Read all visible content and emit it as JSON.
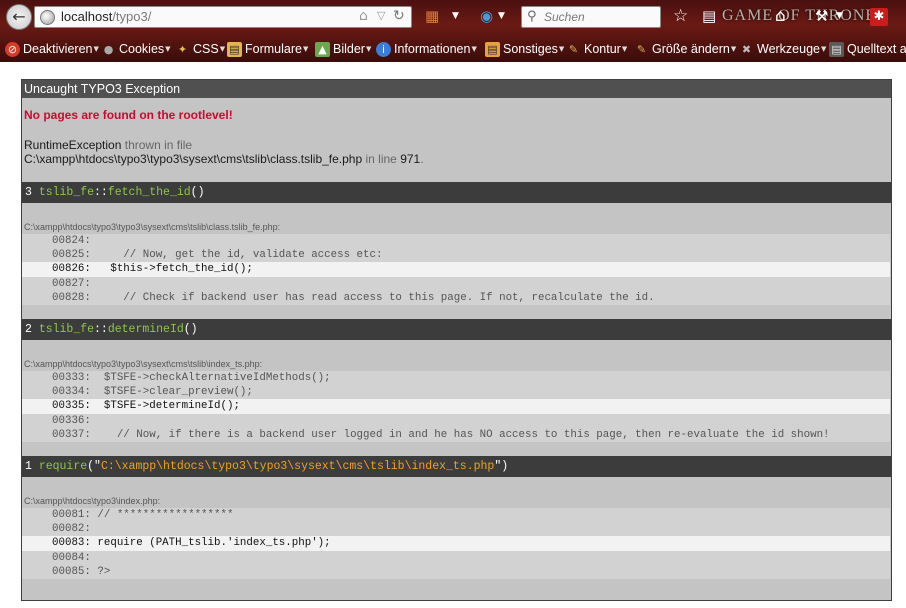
{
  "browser": {
    "url_host": "localhost",
    "url_path": "/typo3/",
    "search_placeholder": "Suchen",
    "theme_logo": "GAME OF THRONES",
    "bookmarks": [
      {
        "label": "Deaktivieren",
        "icon": "no-entry-icon",
        "color": "#d83a2a"
      },
      {
        "label": "Cookies",
        "icon": "cookie-icon",
        "color": "#6b6b6b"
      },
      {
        "label": "CSS",
        "icon": "css-wand-icon",
        "color": "#caa23a"
      },
      {
        "label": "Formulare",
        "icon": "form-icon",
        "color": "#e2b64a"
      },
      {
        "label": "Bilder",
        "icon": "image-icon",
        "color": "#6aa84f"
      },
      {
        "label": "Informationen",
        "icon": "info-icon",
        "color": "#3b7dd8"
      },
      {
        "label": "Sonstiges",
        "icon": "misc-icon",
        "color": "#e8a23a"
      },
      {
        "label": "Kontur",
        "icon": "pencil-icon",
        "color": "#d9a441"
      },
      {
        "label": "Größe ändern",
        "icon": "resize-icon",
        "color": "#d9a441"
      },
      {
        "label": "Werkzeuge",
        "icon": "tools-icon",
        "color": "#9a9a9a"
      },
      {
        "label": "Quelltext an",
        "icon": "source-icon",
        "color": "#5a5a5a"
      }
    ]
  },
  "exception": {
    "title": "Uncaught TYPO3 Exception",
    "message": "No pages are found on the rootlevel!",
    "class_name": "RuntimeException",
    "thrown_in": "thrown in file",
    "file_path": "C:\\xampp\\htdocs\\typo3\\typo3\\sysext\\cms\\tslib\\class.tslib_fe.php",
    "in_line": "in line",
    "line_no": "971",
    "period": "."
  },
  "frames": [
    {
      "num": "3",
      "cls": "tslib_fe",
      "sep": "::",
      "fn": "fetch_the_id",
      "args_open": "(",
      "args": "",
      "args_close": ")",
      "file": "C:\\xampp\\htdocs\\typo3\\typo3\\sysext\\cms\\tslib\\class.tslib_fe.php:",
      "lines": [
        {
          "num": "00824:",
          "code": "",
          "hl": false
        },
        {
          "num": "00825:",
          "code": "    // Now, get the id, validate access etc:",
          "hl": false
        },
        {
          "num": "00826:",
          "code": "  $this->fetch_the_id();",
          "hl": true
        },
        {
          "num": "00827:",
          "code": "",
          "hl": false
        },
        {
          "num": "00828:",
          "code": "    // Check if backend user has read access to this page. If not, recalculate the id.",
          "hl": false
        }
      ]
    },
    {
      "num": "2",
      "cls": "tslib_fe",
      "sep": "::",
      "fn": "determineId",
      "args_open": "(",
      "args": "",
      "args_close": ")",
      "file": "C:\\xampp\\htdocs\\typo3\\typo3\\sysext\\cms\\tslib\\index_ts.php:",
      "lines": [
        {
          "num": "00333:",
          "code": " $TSFE->checkAlternativeIdMethods();",
          "hl": false
        },
        {
          "num": "00334:",
          "code": " $TSFE->clear_preview();",
          "hl": false
        },
        {
          "num": "00335:",
          "code": " $TSFE->determineId();",
          "hl": true
        },
        {
          "num": "00336:",
          "code": "",
          "hl": false
        },
        {
          "num": "00337:",
          "code": "   // Now, if there is a backend user logged in and he has NO access to this page, then re-evaluate the id shown!",
          "hl": false
        }
      ]
    },
    {
      "num": "1",
      "cls": "",
      "sep": "",
      "fn": "require",
      "args_open": "(\"",
      "args": "C:\\xampp\\htdocs\\typo3\\typo3\\sysext\\cms\\tslib\\index_ts.php",
      "args_close": "\")",
      "file": "C:\\xampp\\htdocs\\typo3\\index.php:",
      "lines": [
        {
          "num": "00081:",
          "code": "// ******************",
          "hl": false
        },
        {
          "num": "00082:",
          "code": "",
          "hl": false
        },
        {
          "num": "00083:",
          "code": "require (PATH_tslib.'index_ts.php');",
          "hl": true
        },
        {
          "num": "00084:",
          "code": "",
          "hl": false
        },
        {
          "num": "00085:",
          "code": "?>",
          "hl": false
        }
      ]
    }
  ]
}
